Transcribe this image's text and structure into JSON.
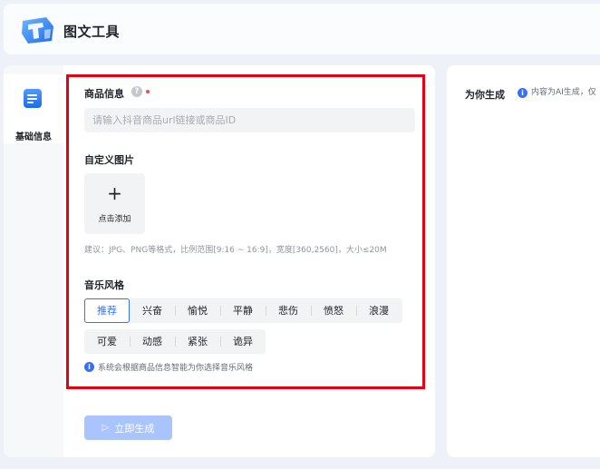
{
  "header": {
    "app_title": "图文工具",
    "logo_icon": "app-logo-icon"
  },
  "side_nav": {
    "items": [
      {
        "label": "基础信息",
        "icon": "document-icon",
        "active": true
      }
    ]
  },
  "form": {
    "product": {
      "label": "商品信息",
      "help_glyph": "?",
      "required": true,
      "value": "",
      "placeholder": "请输入抖音商品url链接或商品ID"
    },
    "custom_image": {
      "label": "自定义图片",
      "upload_glyph": "+",
      "upload_label": "点击添加",
      "hint": "建议：JPG、PNG等格式，比例范围[9:16 ~ 16:9]，宽度[360,2560]，大小≤20M"
    },
    "music_style": {
      "label": "音乐风格",
      "selected": "推荐",
      "row1": [
        "推荐",
        "兴奋",
        "愉悦",
        "平静",
        "悲伤",
        "愤怒",
        "浪漫"
      ],
      "row2": [
        "可爱",
        "动感",
        "紧张",
        "诡异"
      ],
      "info_glyph": "i",
      "note": "系统会根据商品信息智能为你选择音乐风格"
    },
    "generate_button": {
      "icon": "send-icon",
      "glyph": "▷",
      "label": "立即生成"
    }
  },
  "result_panel": {
    "title": "为你生成",
    "info_glyph": "i",
    "note": "内容为AI生成，仅"
  },
  "colors": {
    "accent": "#3370ff",
    "button_disabled": "#a9c4ff",
    "highlight_box": "#e60012",
    "required": "#f54a45"
  }
}
